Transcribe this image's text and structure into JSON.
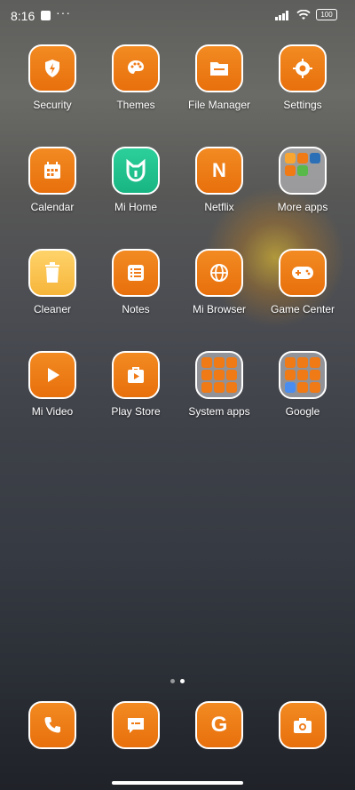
{
  "status_bar": {
    "time": "8:16",
    "notif_dots": "···",
    "battery": "100"
  },
  "apps": [
    {
      "label": "Security",
      "icon": "shield-bolt-icon"
    },
    {
      "label": "Themes",
      "icon": "palette-icon"
    },
    {
      "label": "File Manager",
      "icon": "folder-icon"
    },
    {
      "label": "Settings",
      "icon": "gear-icon"
    },
    {
      "label": "Calendar",
      "icon": "calendar-icon"
    },
    {
      "label": "Mi Home",
      "icon": "mi-home-icon"
    },
    {
      "label": "Netflix",
      "icon": "netflix-n-icon",
      "glyph": "N"
    },
    {
      "label": "More apps",
      "icon": "folder-more-apps-icon"
    },
    {
      "label": "Cleaner",
      "icon": "trash-bin-icon"
    },
    {
      "label": "Notes",
      "icon": "notes-list-icon"
    },
    {
      "label": "Mi Browser",
      "icon": "globe-icon"
    },
    {
      "label": "Game Center",
      "icon": "gamepad-icon"
    },
    {
      "label": "Mi Video",
      "icon": "play-icon"
    },
    {
      "label": "Play Store",
      "icon": "play-store-icon"
    },
    {
      "label": "System apps",
      "icon": "folder-system-apps-icon"
    },
    {
      "label": "Google",
      "icon": "folder-google-icon"
    }
  ],
  "dock": [
    {
      "icon": "phone-icon"
    },
    {
      "icon": "messages-icon"
    },
    {
      "icon": "google-g-icon",
      "glyph": "G"
    },
    {
      "icon": "camera-icon"
    }
  ],
  "colors": {
    "icon_orange": "#ef7a16",
    "mi_home_green": "#20c28c",
    "cleaner_yellow": "#f8c24a"
  }
}
